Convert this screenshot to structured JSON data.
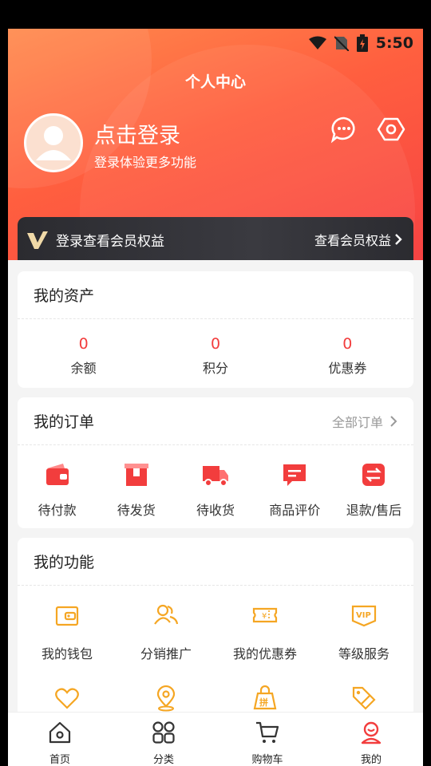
{
  "status": {
    "time": "5:50"
  },
  "page_title": "个人中心",
  "login": {
    "title": "点击登录",
    "subtitle": "登录体验更多功能"
  },
  "vip_bar": {
    "left_text": "登录查看会员权益",
    "right_text": "查看会员权益"
  },
  "assets": {
    "title": "我的资产",
    "items": [
      {
        "value": "0",
        "label": "余额"
      },
      {
        "value": "0",
        "label": "积分"
      },
      {
        "value": "0",
        "label": "优惠券"
      }
    ]
  },
  "orders": {
    "title": "我的订单",
    "more": "全部订单",
    "items": [
      {
        "label": "待付款",
        "icon": "wallet-icon"
      },
      {
        "label": "待发货",
        "icon": "box-icon"
      },
      {
        "label": "待收货",
        "icon": "truck-icon"
      },
      {
        "label": "商品评价",
        "icon": "comment-icon"
      },
      {
        "label": "退款/售后",
        "icon": "exchange-icon"
      }
    ]
  },
  "functions": {
    "title": "我的功能",
    "items": [
      {
        "label": "我的钱包",
        "icon": "wallet-outline-icon"
      },
      {
        "label": "分销推广",
        "icon": "users-icon"
      },
      {
        "label": "我的优惠券",
        "icon": "coupon-icon"
      },
      {
        "label": "等级服务",
        "icon": "vip-icon"
      },
      {
        "label": "",
        "icon": "heart-icon"
      },
      {
        "label": "",
        "icon": "location-icon"
      },
      {
        "label": "",
        "icon": "group-buy-icon"
      },
      {
        "label": "",
        "icon": "tag-icon"
      }
    ]
  },
  "tabbar": {
    "items": [
      {
        "label": "首页",
        "icon": "home-icon"
      },
      {
        "label": "分类",
        "icon": "grid-icon"
      },
      {
        "label": "购物车",
        "icon": "cart-icon"
      },
      {
        "label": "我的",
        "icon": "user-icon"
      }
    ]
  },
  "colors": {
    "accent": "#f23d3d",
    "orange_icon": "#f5a623",
    "vip_bar": "#2f2f35"
  }
}
